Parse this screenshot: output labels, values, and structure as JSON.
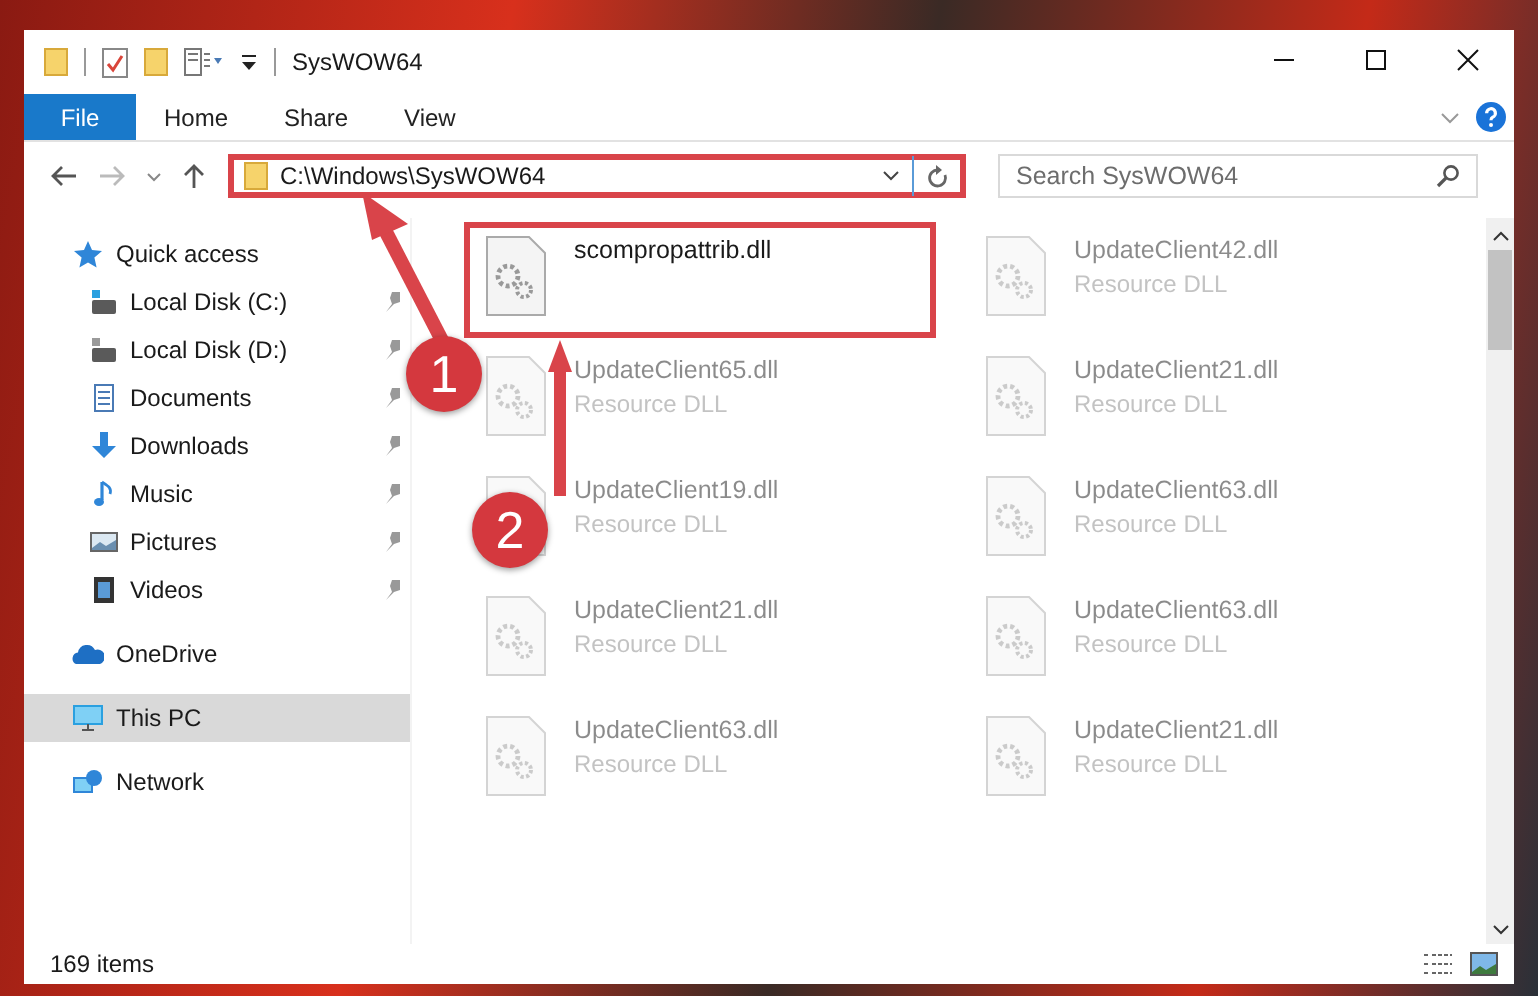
{
  "window": {
    "title": "SysWOW64"
  },
  "ribbon": {
    "tabs": [
      {
        "label": "File",
        "kind": "file"
      },
      {
        "label": "Home",
        "kind": "tab"
      },
      {
        "label": "Share",
        "kind": "tab"
      },
      {
        "label": "View",
        "kind": "tab"
      }
    ]
  },
  "address_bar": {
    "path": "C:\\Windows\\SysWOW64",
    "highlighted": true
  },
  "search": {
    "placeholder": "Search SysWOW64"
  },
  "sidebar": {
    "items": [
      {
        "label": "Quick access",
        "kind": "star",
        "selected": false,
        "children": [
          {
            "label": "Local Disk (C:)",
            "kind": "drive-c",
            "pinned": true,
            "selected": false
          },
          {
            "label": "Local Disk (D:)",
            "kind": "drive",
            "pinned": true,
            "selected": false
          },
          {
            "label": "Documents",
            "kind": "documents",
            "pinned": true,
            "selected": false
          },
          {
            "label": "Downloads",
            "kind": "downloads",
            "pinned": true,
            "selected": false
          },
          {
            "label": "Music",
            "kind": "music",
            "pinned": true,
            "selected": false
          },
          {
            "label": "Pictures",
            "kind": "pictures",
            "pinned": true,
            "selected": false
          },
          {
            "label": "Videos",
            "kind": "videos",
            "pinned": true,
            "selected": false
          }
        ]
      },
      {
        "label": "OneDrive",
        "kind": "cloud",
        "selected": false
      },
      {
        "label": "This PC",
        "kind": "pc",
        "selected": true
      },
      {
        "label": "Network",
        "kind": "network",
        "selected": false
      }
    ]
  },
  "files": [
    {
      "name": "scompropattrib.dll",
      "highlighted": true
    },
    {
      "name": "UpdateClient42.dll",
      "type": "Resource DLL",
      "highlighted": false
    },
    {
      "name": "UpdateClient65.dll",
      "type": "Resource DLL",
      "highlighted": false
    },
    {
      "name": "UpdateClient21.dll",
      "type": "Resource DLL",
      "highlighted": false
    },
    {
      "name": "UpdateClient19.dll",
      "type": "Resource DLL",
      "highlighted": false
    },
    {
      "name": "UpdateClient63.dll",
      "type": "Resource DLL",
      "highlighted": false
    },
    {
      "name": "UpdateClient21.dll",
      "type": "Resource DLL",
      "highlighted": false
    },
    {
      "name": "UpdateClient63.dll",
      "type": "Resource DLL",
      "highlighted": false
    },
    {
      "name": "UpdateClient63.dll",
      "type": "Resource DLL",
      "highlighted": false
    },
    {
      "name": "UpdateClient21.dll",
      "type": "Resource DLL",
      "highlighted": false
    }
  ],
  "annotations": [
    {
      "number": "1"
    },
    {
      "number": "2"
    }
  ],
  "status_bar": {
    "item_count": "169 items"
  }
}
